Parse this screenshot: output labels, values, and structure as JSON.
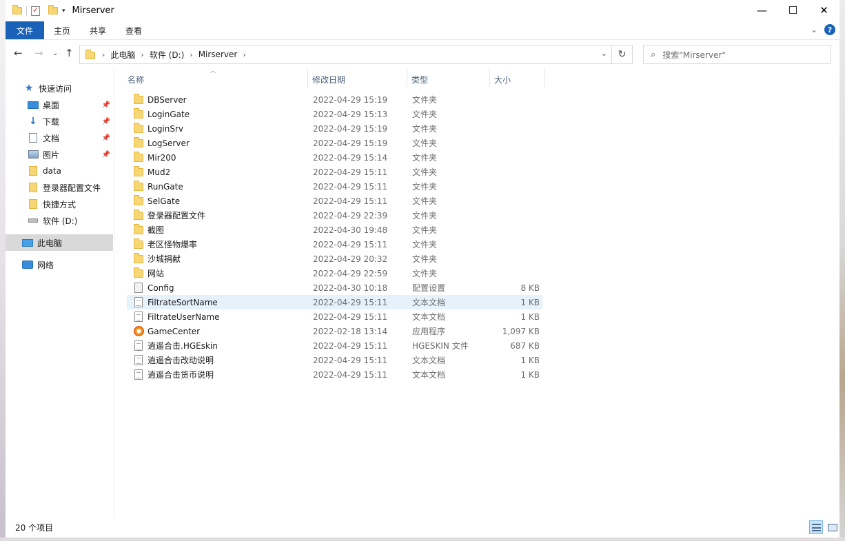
{
  "window": {
    "title": "Mirserver"
  },
  "ribbon": {
    "tabs": [
      "文件",
      "主页",
      "共享",
      "查看"
    ]
  },
  "address": {
    "crumbs": [
      "此电脑",
      "软件 (D:)",
      "Mirserver"
    ],
    "search_placeholder": "搜索\"Mirserver\""
  },
  "sidebar": {
    "items": [
      {
        "label": "快速访问"
      },
      {
        "label": "桌面",
        "pinned": true
      },
      {
        "label": "下载",
        "pinned": true
      },
      {
        "label": "文档",
        "pinned": true
      },
      {
        "label": "图片",
        "pinned": true
      },
      {
        "label": "data"
      },
      {
        "label": "登录器配置文件"
      },
      {
        "label": "快捷方式"
      },
      {
        "label": "软件 (D:)"
      },
      {
        "label": "此电脑",
        "selected": true
      },
      {
        "label": "网络"
      }
    ]
  },
  "columns": [
    "名称",
    "修改日期",
    "类型",
    "大小"
  ],
  "files": [
    {
      "name": "DBServer",
      "date": "2022-04-29 15:19",
      "type": "文件夹",
      "size": "",
      "icon": "folder-icon"
    },
    {
      "name": "LoginGate",
      "date": "2022-04-29 15:13",
      "type": "文件夹",
      "size": "",
      "icon": "folder-icon"
    },
    {
      "name": "LoginSrv",
      "date": "2022-04-29 15:19",
      "type": "文件夹",
      "size": "",
      "icon": "folder-icon"
    },
    {
      "name": "LogServer",
      "date": "2022-04-29 15:19",
      "type": "文件夹",
      "size": "",
      "icon": "folder-icon"
    },
    {
      "name": "Mir200",
      "date": "2022-04-29 15:14",
      "type": "文件夹",
      "size": "",
      "icon": "folder-icon"
    },
    {
      "name": "Mud2",
      "date": "2022-04-29 15:11",
      "type": "文件夹",
      "size": "",
      "icon": "folder-icon"
    },
    {
      "name": "RunGate",
      "date": "2022-04-29 15:11",
      "type": "文件夹",
      "size": "",
      "icon": "folder-icon"
    },
    {
      "name": "SelGate",
      "date": "2022-04-29 15:11",
      "type": "文件夹",
      "size": "",
      "icon": "folder-icon"
    },
    {
      "name": "登录器配置文件",
      "date": "2022-04-29 22:39",
      "type": "文件夹",
      "size": "",
      "icon": "folder-icon"
    },
    {
      "name": "截图",
      "date": "2022-04-30 19:48",
      "type": "文件夹",
      "size": "",
      "icon": "folder-icon"
    },
    {
      "name": "老区怪物爆率",
      "date": "2022-04-29 15:11",
      "type": "文件夹",
      "size": "",
      "icon": "folder-icon"
    },
    {
      "name": "沙城捐献",
      "date": "2022-04-29 20:32",
      "type": "文件夹",
      "size": "",
      "icon": "folder-icon"
    },
    {
      "name": "网站",
      "date": "2022-04-29 22:59",
      "type": "文件夹",
      "size": "",
      "icon": "folder-icon"
    },
    {
      "name": "Config",
      "date": "2022-04-30 10:18",
      "type": "配置设置",
      "size": "8 KB",
      "icon": "config-file-icon"
    },
    {
      "name": "FiltrateSortName",
      "date": "2022-04-29 15:11",
      "type": "文本文档",
      "size": "1 KB",
      "icon": "text-file-icon",
      "hover": true
    },
    {
      "name": "FiltrateUserName",
      "date": "2022-04-29 15:11",
      "type": "文本文档",
      "size": "1 KB",
      "icon": "text-file-icon"
    },
    {
      "name": "GameCenter",
      "date": "2022-02-18 13:14",
      "type": "应用程序",
      "size": "1,097 KB",
      "icon": "app-icon"
    },
    {
      "name": "逍遥合击.HGEskin",
      "date": "2022-04-29 15:11",
      "type": "HGESKIN 文件",
      "size": "687 KB",
      "icon": "text-file-icon"
    },
    {
      "name": "逍遥合击改动说明",
      "date": "2022-04-29 15:11",
      "type": "文本文档",
      "size": "1 KB",
      "icon": "text-file-icon"
    },
    {
      "name": "逍遥合击货币说明",
      "date": "2022-04-29 15:11",
      "type": "文本文档",
      "size": "1 KB",
      "icon": "text-file-icon"
    }
  ],
  "status": {
    "item_count": "20 个项目"
  },
  "colors": {
    "accent": "#1a62b8",
    "hover_row": "#e5f1fb",
    "selected_nav": "#d9d9d9"
  }
}
